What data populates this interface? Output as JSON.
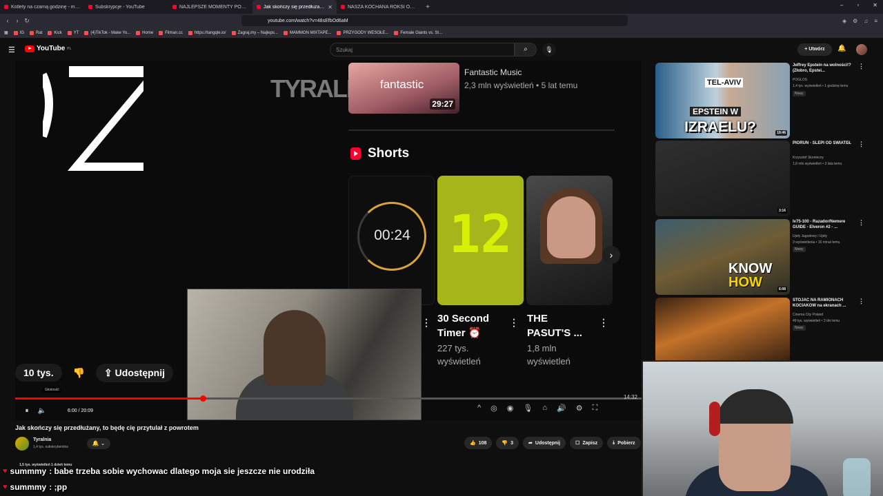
{
  "browser": {
    "tabs": [
      {
        "label": "Kotlety na czarną godzinę - mogą st..."
      },
      {
        "label": "Subskrypcje - YouTube"
      },
      {
        "label": "NAJLEPSZE MOMENTY POLSKIEGO ..."
      },
      {
        "label": "Jak skończy się przedłużany, ..."
      },
      {
        "label": "NASZA KOCHANA ROKSI ODESZŁA"
      }
    ],
    "url": "youtube.com/watch?v=48sEfbOd6aM",
    "bookmarks": [
      "IG",
      "Rat",
      "Kick",
      "YT",
      "(4)TikTok - Make Yo...",
      "Home",
      "Filman.cc",
      "https://tangqle.io/",
      "Zagraj.my – Najleps...",
      "MAMMON MIXTAPE...",
      "PRZYGODY WESOŁE...",
      "Female Giants vs. St..."
    ]
  },
  "youtube": {
    "logo": "YouTube",
    "country": "PL",
    "search_placeholder": "Szukaj",
    "create_label": "Utwórz"
  },
  "player": {
    "fm_name": "fantastic",
    "fm_duration": "29:27",
    "fm_channel": "Fantastic Music",
    "fm_meta": "2,3 mln wyświetleń • 5 lat temu",
    "logo_text": "TYRALNIA",
    "shorts_title": "Shorts",
    "shorts": [
      {
        "title_l1": "30 Second",
        "title_l2": "Timer ⏰",
        "views_l1": "227 tys.",
        "views_l2": "wyświetleń",
        "overlay": "00:24"
      },
      {
        "title_l1": "THE",
        "title_l2": "PASUT'S ...",
        "views_l1": "1,8 mln",
        "views_l2": "wyświetleń",
        "overlay": "12"
      }
    ],
    "likes_pill": "10 tys.",
    "share_pill": "Udostępnij",
    "volume_tip": "Głośność",
    "time": "6:00 / 20:09",
    "clock": "14:32",
    "progress_fraction": 0.3
  },
  "video": {
    "title": "Jak skończy się przedłużany, to będę cię przytulał z powrotem",
    "channel": "Tyralnia",
    "subs": "1,4 tys. subskrybentów",
    "likes": "108",
    "dislikes": "3",
    "share": "Udostępnij",
    "save": "Zapisz",
    "download": "Pobierz",
    "meta": "1,5 tys. wyświetleń  1 dzień temu"
  },
  "chat": [
    {
      "user": "summmy",
      "msg": ": babe trzeba sobie wychowac dlatego moja sie jeszcze nie urodziła"
    },
    {
      "user": "summmy",
      "msg": ": ;pp"
    }
  ],
  "recommendations": [
    {
      "title": "Jeffrey Epstein na wolności!? (Złobro, Epstei...",
      "channel": "POGLOS",
      "views": "1,4 tys. wyświetleń • 1 godzinę temu",
      "badge": "Nowy",
      "duration": "19:46",
      "overlay1": "TEL-AVIV",
      "overlay2": "EPSTEIN W",
      "overlay3": "IZRAELU?"
    },
    {
      "title": "PIORUN - SLEPI OD SWIATEŁ",
      "channel": "Krzysztof Skoniecny",
      "views": "1,8 mln wyświetleń • 3 lata temu",
      "badge": "",
      "duration": "3:16"
    },
    {
      "title": "lv75-100 - Razador/Nemere GUIDE - Elveron #2 - ...",
      "channel": "Ujeły Jagodowy i Ujeły",
      "views": "3 wyświetlenia • 16 minut temu",
      "badge": "Nowy",
      "duration": "6:08",
      "overlay1": "KNOW",
      "overlay2": "HOW"
    },
    {
      "title": "STOJAC NA RAMIONACH KOCIAKOW na ekranach ...",
      "channel": "Cinema City Poland",
      "views": "49 tys. wyświetleń • 3 dni temu",
      "badge": "Nowy",
      "duration": ""
    }
  ]
}
